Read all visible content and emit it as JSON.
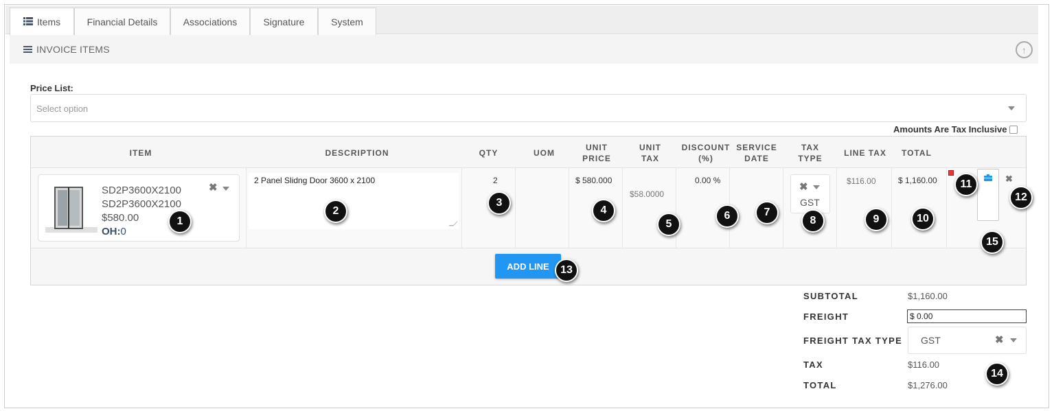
{
  "tabs": [
    {
      "label": "Items"
    },
    {
      "label": "Financial Details"
    },
    {
      "label": "Associations"
    },
    {
      "label": "Signature"
    },
    {
      "label": "System"
    }
  ],
  "section": {
    "title": "INVOICE ITEMS"
  },
  "price_list": {
    "label": "Price List:",
    "placeholder": "Select option"
  },
  "tax_inclusive": {
    "label": "Amounts Are Tax Inclusive",
    "checked": false
  },
  "columns": {
    "item": "ITEM",
    "description": "DESCRIPTION",
    "qty": "QTY",
    "uom": "UOM",
    "unit_price_1": "UNIT",
    "unit_price_2": "PRICE",
    "unit_tax_1": "UNIT",
    "unit_tax_2": "TAX",
    "discount_1": "DISCOUNT",
    "discount_2": "(%)",
    "service_date_1": "SERVICE",
    "service_date_2": "DATE",
    "tax_type_1": "TAX",
    "tax_type_2": "TYPE",
    "line_tax": "LINE TAX",
    "total": "TOTAL"
  },
  "line": {
    "item_code_1": "SD2P3600X2100",
    "item_code_2": "SD2P3600X2100",
    "item_price": "$580.00",
    "on_hand_label": "OH:",
    "on_hand_value": "0",
    "description": "2 Panel Slidng Door 3600 x 2100",
    "qty": "2",
    "uom": "",
    "unit_price": "$ 580.000",
    "unit_tax": "$58.0000",
    "discount": "0.00 %",
    "service_date": "",
    "tax_type": "GST",
    "line_tax": "$116.00",
    "total": "$ 1,160.00"
  },
  "add_line": {
    "label": "ADD LINE"
  },
  "summary": {
    "subtotal_label": "SUBTOTAL",
    "subtotal": "$1,160.00",
    "freight_label": "FREIGHT",
    "freight": "$ 0.00",
    "freight_tax_type_label": "FREIGHT TAX TYPE",
    "freight_tax_type": "GST",
    "tax_label": "TAX",
    "tax": "$116.00",
    "total_label": "TOTAL",
    "total": "$1,276.00"
  },
  "callouts": {
    "c1": "1",
    "c2": "2",
    "c3": "3",
    "c4": "4",
    "c5": "5",
    "c6": "6",
    "c7": "7",
    "c8": "8",
    "c9": "9",
    "c10": "10",
    "c11": "11",
    "c12": "12",
    "c13": "13",
    "c14": "14",
    "c15": "15"
  },
  "colors": {
    "accent": "#2196f3",
    "callout": "#111111",
    "header_text": "#45566b"
  },
  "icons": [
    "list-icon",
    "menu-icon",
    "collapse-up-icon",
    "clear-icon",
    "chevron-down-icon",
    "briefcase-icon",
    "remove-row-icon",
    "door-image"
  ]
}
